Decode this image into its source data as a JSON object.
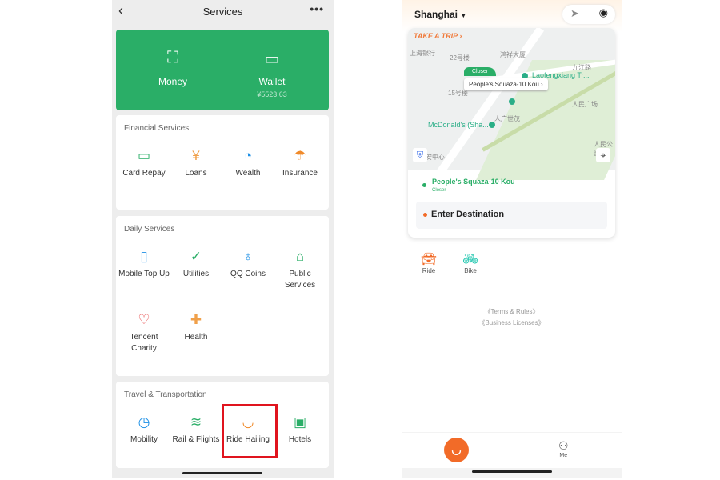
{
  "left": {
    "header": {
      "title": "Services",
      "back_icon": "‹",
      "more_icon": "•••"
    },
    "top_card": {
      "money": {
        "label": "Money",
        "icon": "scan-check"
      },
      "wallet": {
        "label": "Wallet",
        "balance": "¥5523.63",
        "icon": "wallet"
      }
    },
    "sections": [
      {
        "title": "Financial Services",
        "items": [
          {
            "label": "Card Repay",
            "icon": "▭",
            "color": "#2aae67"
          },
          {
            "label": "Loans",
            "icon": "¥",
            "color": "#f0a04a"
          },
          {
            "label": "Wealth",
            "icon": "◔",
            "color": "#1e90e6"
          },
          {
            "label": "Insurance",
            "icon": "☂",
            "color": "#f08a2a"
          }
        ]
      },
      {
        "title": "Daily Services",
        "items": [
          {
            "label": "Mobile Top Up",
            "icon": "▯",
            "color": "#1e90e6"
          },
          {
            "label": "Utilities",
            "icon": "✓",
            "color": "#2aae67"
          },
          {
            "label": "QQ Coins",
            "icon": "♁",
            "color": "#1e90e6"
          },
          {
            "label": "Public Services",
            "icon": "⌂",
            "color": "#2aae67"
          },
          {
            "label": "Tencent Charity",
            "icon": "♡",
            "color": "#e85050"
          },
          {
            "label": "Health",
            "icon": "✚",
            "color": "#f0a04a"
          }
        ]
      },
      {
        "title": "Travel & Transportation",
        "items": [
          {
            "label": "Mobility",
            "icon": "◷",
            "color": "#1e90e6"
          },
          {
            "label": "Rail & Flights",
            "icon": "≋",
            "color": "#2aae67"
          },
          {
            "label": "Ride Hailing",
            "icon": "◡",
            "color": "#f08a2a"
          },
          {
            "label": "Hotels",
            "icon": "▣",
            "color": "#2aae67"
          }
        ]
      }
    ],
    "highlight_color": "#e0141e"
  },
  "right": {
    "city": "Shanghai",
    "take_trip": "TAKE A TRIP ›",
    "map_labels": [
      "上海银行",
      "22号楼",
      "鸿祥大厦",
      "九江路",
      "15号楼",
      "人广世茂",
      "人民广场",
      "McDonald's (Sha...",
      "Laofengxiang Tr...",
      "安中心",
      "人民公园"
    ],
    "closer_tag": "Closer",
    "bubble": "People's Squaza-10 Kou ›",
    "pickup": {
      "name": "People's Squaza-10 Kou",
      "tag": "Closer"
    },
    "destination_placeholder": "Enter Destination",
    "services": [
      {
        "label": "Ride",
        "icon": "car",
        "color": "#f26b28"
      },
      {
        "label": "Bike",
        "icon": "bike",
        "color": "#22c7b0"
      }
    ],
    "links": [
      "《Terms & Rules》",
      "《Business Licenses》"
    ],
    "nav": {
      "me": "Me",
      "home_icon": "didi-logo"
    },
    "accent": "#f26b28"
  }
}
